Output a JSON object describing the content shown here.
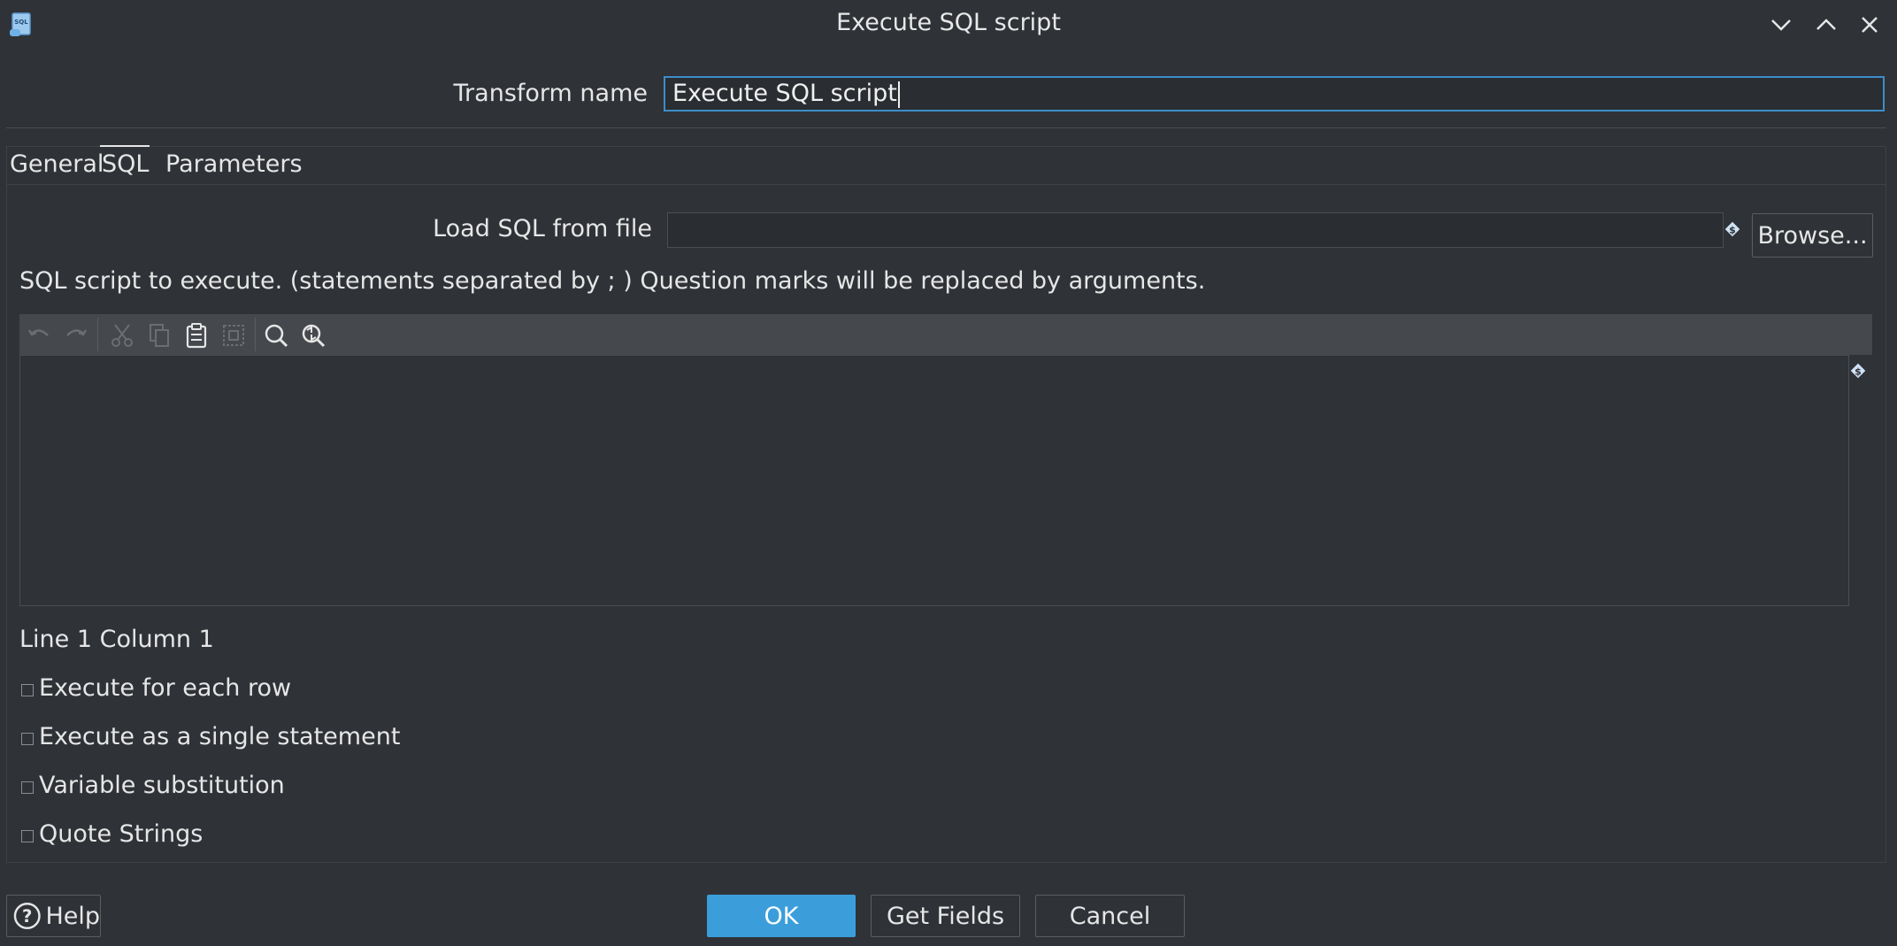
{
  "window": {
    "title": "Execute SQL script",
    "controls": [
      "minimize",
      "maximize",
      "close"
    ]
  },
  "transform": {
    "label": "Transform name",
    "value": "Execute SQL script"
  },
  "tabs": [
    {
      "label": "General",
      "selected": false
    },
    {
      "label": "SQL",
      "selected": true
    },
    {
      "label": "Parameters",
      "selected": false
    }
  ],
  "load_sql": {
    "label": "Load SQL from file",
    "value": "",
    "browse_label": "Browse..."
  },
  "sql_description": "SQL script to execute. (statements separated by ; ) Question marks will be replaced by arguments.",
  "editor": {
    "content": "",
    "toolbar_icons": [
      "undo-icon",
      "redo-icon",
      "cut-icon",
      "copy-icon",
      "paste-icon",
      "select-all-icon",
      "search-icon",
      "replace-icon"
    ]
  },
  "position_status": "Line 1 Column 1",
  "options": [
    {
      "label": "Execute for each row",
      "checked": false
    },
    {
      "label": "Execute as a single statement",
      "checked": false
    },
    {
      "label": "Variable substitution",
      "checked": false
    },
    {
      "label": "Quote Strings",
      "checked": false
    }
  ],
  "buttons": {
    "help": "Help",
    "ok": "OK",
    "get_fields": "Get Fields",
    "cancel": "Cancel"
  },
  "colors": {
    "background": "#2f3237",
    "accent": "#3b9edb",
    "focus_border": "#3d8ec9",
    "toolbar": "#45484c"
  }
}
